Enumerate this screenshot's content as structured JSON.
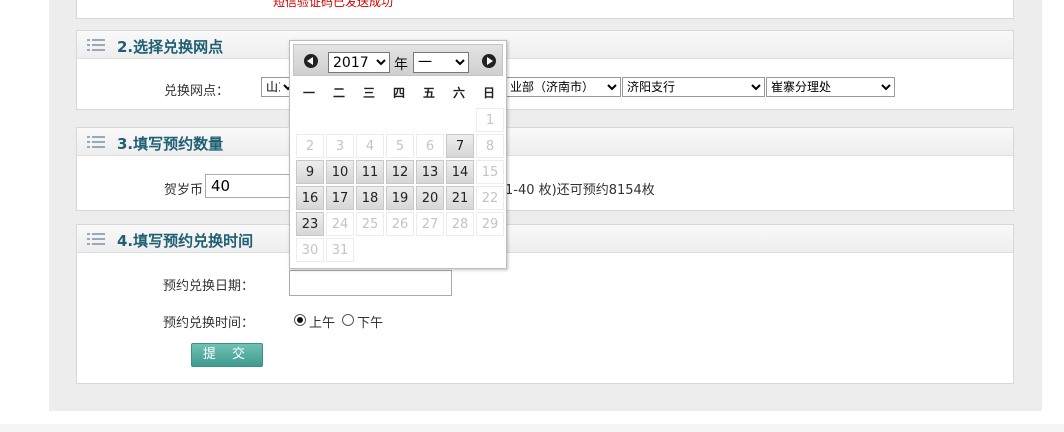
{
  "sms_status": "短信验证码已发送成功",
  "section2": {
    "title": "2.选择兑换网点",
    "label": "兑换网点：",
    "province": "山东",
    "branch": "业部（济南市）",
    "subbranch": "济阳支行",
    "office": "崔寨分理处"
  },
  "section3": {
    "title": "3.填写预约数量",
    "coin_label": "贺岁币",
    "quantity": "40",
    "hint": "1-40 枚)还可预约8154枚"
  },
  "section4": {
    "title": "4.填写预约兑换时间",
    "date_label": "预约兑换日期：",
    "date_value": "",
    "time_label": "预约兑换时间：",
    "am_label": "上午",
    "pm_label": "下午",
    "selected": "am",
    "submit_label": "提 交"
  },
  "calendar": {
    "year": "2017",
    "year_suffix": "年",
    "month": "一",
    "weekdays": [
      "一",
      "二",
      "三",
      "四",
      "五",
      "六",
      "日"
    ],
    "days": [
      {
        "d": "1",
        "state": "disabled"
      },
      {
        "d": "2",
        "state": "disabled"
      },
      {
        "d": "3",
        "state": "disabled"
      },
      {
        "d": "4",
        "state": "disabled"
      },
      {
        "d": "5",
        "state": "disabled"
      },
      {
        "d": "6",
        "state": "disabled"
      },
      {
        "d": "7",
        "state": "available"
      },
      {
        "d": "8",
        "state": "disabled"
      },
      {
        "d": "9",
        "state": "available"
      },
      {
        "d": "10",
        "state": "available"
      },
      {
        "d": "11",
        "state": "available"
      },
      {
        "d": "12",
        "state": "available"
      },
      {
        "d": "13",
        "state": "available"
      },
      {
        "d": "14",
        "state": "available"
      },
      {
        "d": "15",
        "state": "disabled"
      },
      {
        "d": "16",
        "state": "available"
      },
      {
        "d": "17",
        "state": "available"
      },
      {
        "d": "18",
        "state": "available"
      },
      {
        "d": "19",
        "state": "available"
      },
      {
        "d": "20",
        "state": "available"
      },
      {
        "d": "21",
        "state": "available"
      },
      {
        "d": "22",
        "state": "disabled"
      },
      {
        "d": "23",
        "state": "available"
      },
      {
        "d": "24",
        "state": "disabled"
      },
      {
        "d": "25",
        "state": "disabled"
      },
      {
        "d": "26",
        "state": "disabled"
      },
      {
        "d": "27",
        "state": "disabled"
      },
      {
        "d": "28",
        "state": "disabled"
      },
      {
        "d": "29",
        "state": "disabled"
      },
      {
        "d": "30",
        "state": "disabled"
      },
      {
        "d": "31",
        "state": "disabled"
      }
    ]
  }
}
